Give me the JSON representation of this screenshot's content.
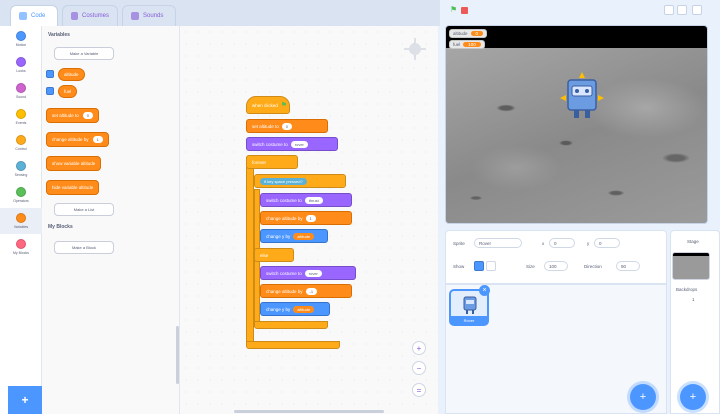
{
  "tabs": [
    {
      "label": "Code",
      "active": true
    },
    {
      "label": "Costumes",
      "active": false
    },
    {
      "label": "Sounds",
      "active": false
    }
  ],
  "categories": [
    {
      "label": "Motion",
      "color": "#4c97ff"
    },
    {
      "label": "Looks",
      "color": "#9966ff"
    },
    {
      "label": "Sound",
      "color": "#cf63cf"
    },
    {
      "label": "Events",
      "color": "#ffbf00"
    },
    {
      "label": "Control",
      "color": "#ffab19"
    },
    {
      "label": "Sensing",
      "color": "#5cb1d6"
    },
    {
      "label": "Operators",
      "color": "#59c059"
    },
    {
      "label": "Variables",
      "color": "#ff8c1a"
    },
    {
      "label": "My Blocks",
      "color": "#ff6680"
    }
  ],
  "palette": {
    "heading": "Variables",
    "make_variable": "Make a Variable",
    "variables": [
      "altitude",
      "fuel"
    ],
    "blocks": [
      {
        "text": "set altitude to",
        "value": "0"
      },
      {
        "text": "change altitude by",
        "value": "1"
      },
      {
        "text": "show variable altitude",
        "value": ""
      },
      {
        "text": "hide variable altitude",
        "value": ""
      }
    ],
    "make_list": "Make a List",
    "myblocks_heading": "My Blocks",
    "make_block": "Make a Block"
  },
  "script": [
    {
      "cls": "orange hat",
      "text": "when clicked",
      "value": ""
    },
    {
      "cls": "var",
      "text": "set altitude to",
      "value": "0"
    },
    {
      "cls": "looks",
      "text": "switch costume to",
      "value": "rover"
    },
    {
      "cls": "orange",
      "text": "forever",
      "value": ""
    },
    {
      "cls": "sense",
      "text": "if key space pressed?",
      "value": ""
    },
    {
      "cls": "looks",
      "text": "switch costume to",
      "value": "thrust"
    },
    {
      "cls": "var",
      "text": "change altitude by",
      "value": "1"
    },
    {
      "cls": "motion",
      "text": "change y by",
      "value": "altitude"
    },
    {
      "cls": "orange",
      "text": "else",
      "value": ""
    },
    {
      "cls": "looks",
      "text": "switch costume to",
      "value": "rover"
    },
    {
      "cls": "var",
      "text": "change altitude by",
      "value": "-1"
    },
    {
      "cls": "motion",
      "text": "change y by",
      "value": "altitude"
    }
  ],
  "stage": {
    "monitors": [
      {
        "label": "altitude",
        "value": "0"
      },
      {
        "label": "fuel",
        "value": "100"
      }
    ]
  },
  "sprite_info": {
    "sprite_label": "Sprite",
    "sprite_name": "Rover",
    "x_label": "x",
    "x_value": "0",
    "y_label": "y",
    "y_value": "0",
    "show_label": "Show",
    "size_label": "Size",
    "size_value": "100",
    "direction_label": "Direction",
    "direction_value": "90"
  },
  "sprites": [
    {
      "name": "Rover"
    }
  ],
  "stage_panel": {
    "title": "Stage",
    "backdrops_label": "Backdrops",
    "backdrops_count": "1"
  }
}
